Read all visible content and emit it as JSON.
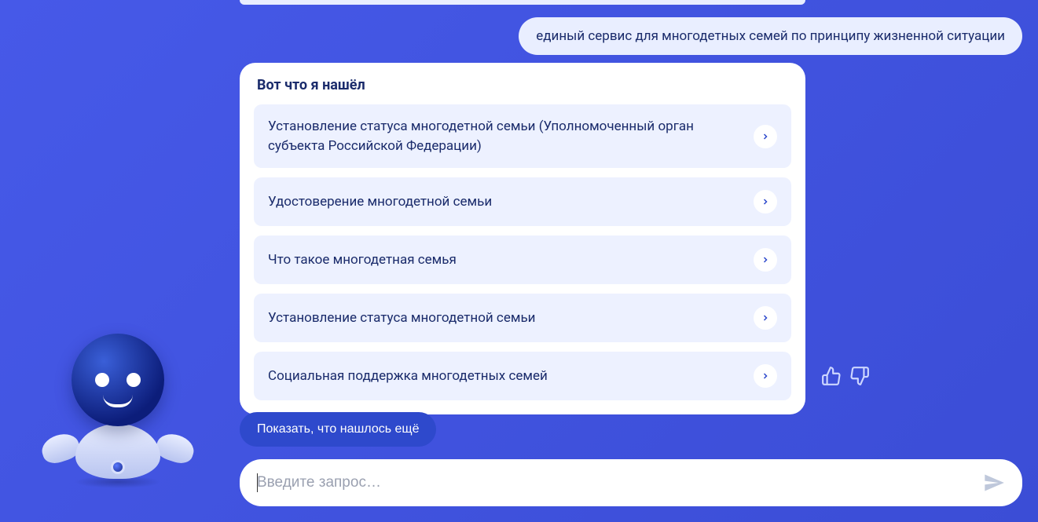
{
  "userMessage": "единый сервис для многодетных семей по принципу жизненной ситуации",
  "botHeading": "Вот что я нашёл",
  "results": [
    "Установление статуса многодетной семьи (Уполномоченный орган субъекта Российской Федерации)",
    "Удостоверение многодетной семьи",
    "Что такое многодетная семья",
    "Установление статуса многодетной семьи",
    "Социальная поддержка многодетных семей"
  ],
  "showMoreLabel": "Показать, что нашлось ещё",
  "inputPlaceholder": "Введите запрос…"
}
